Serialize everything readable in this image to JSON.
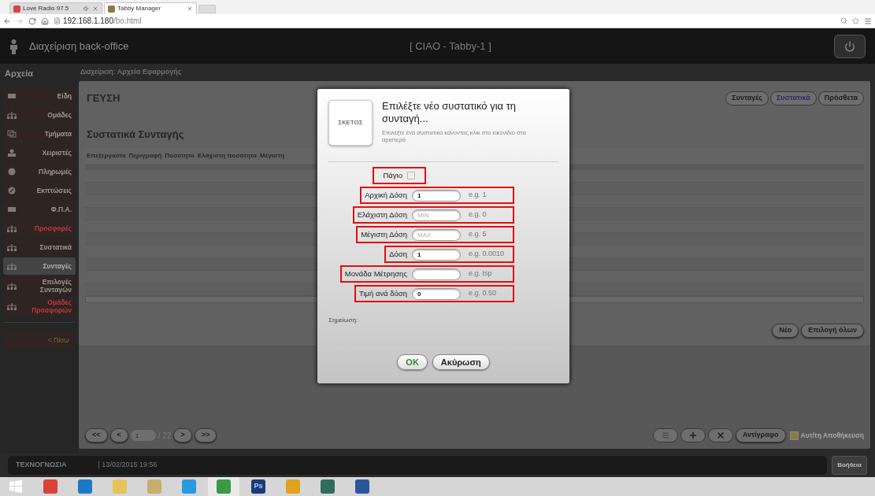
{
  "browser": {
    "tabs": [
      {
        "title": "Love Radio 97.5",
        "selected": false,
        "audio": true
      },
      {
        "title": "Tabby Manager",
        "selected": true,
        "audio": false
      }
    ],
    "address": {
      "host": "192.168.1.180",
      "path": "/bo.html"
    }
  },
  "header": {
    "title": "Διαχείριση back-office",
    "terminal": "[ CIAO - Tabby-1 ]"
  },
  "sidebar": {
    "title": "Αρχεία",
    "items": [
      {
        "label": "Είδη",
        "kind": "square",
        "warning": false,
        "selected": false
      },
      {
        "label": "Ομάδες",
        "kind": "tree",
        "warning": false,
        "selected": false
      },
      {
        "label": "Τμήματα",
        "kind": "windows",
        "warning": false,
        "selected": false
      },
      {
        "label": "Χειριστές",
        "kind": "person",
        "warning": false,
        "selected": false
      },
      {
        "label": "Πληρωμές",
        "kind": "coin",
        "warning": false,
        "selected": false
      },
      {
        "label": "Εκπτώσεις",
        "kind": "discount",
        "warning": false,
        "selected": false
      },
      {
        "label": "Φ.Π.Α.",
        "kind": "square",
        "warning": false,
        "selected": false
      },
      {
        "label": "Προσφορές",
        "kind": "tree",
        "warning": true,
        "selected": false
      },
      {
        "label": "Συστατικά",
        "kind": "tree",
        "warning": false,
        "selected": false
      },
      {
        "label": "Συνταγές",
        "kind": "tree",
        "warning": false,
        "selected": true
      },
      {
        "label": "Επιλογές Συνταγών",
        "kind": "tree",
        "warning": false,
        "selected": false
      },
      {
        "label": "Ομάδες Προσφορών",
        "kind": "tree",
        "warning": true,
        "selected": false
      }
    ],
    "back": "< Πίσω"
  },
  "breadcrumb": {
    "prefix": "Διαχείριση:",
    "current": "Αρχεία Εφαρμογής"
  },
  "recipe": {
    "name": "ΓΕΥΣΗ",
    "tabs": [
      {
        "label": "Συνταγές",
        "selected": false
      },
      {
        "label": "Συστατικά",
        "selected": true
      },
      {
        "label": "Πρόσθετα",
        "selected": false
      }
    ],
    "section_title": "Συστατικά Συνταγής",
    "table": {
      "columns": [
        "Επεξεργασία",
        "Περιγραφή",
        "Ποσότητα",
        "Ελάχιστη ποσότητα",
        "Μέγιστη"
      ]
    },
    "actions": [
      "Νέο",
      "Επιλογή όλων"
    ]
  },
  "pager": {
    "first": "<<",
    "prev": "<",
    "page": "1",
    "total": "/ 22",
    "next": ">",
    "last": ">>"
  },
  "toolbar": {
    "copy": "Αντίγραφο",
    "autosave": {
      "label": "Αυτ/τη Αποθήκευση",
      "checked": false
    }
  },
  "dialog": {
    "thumbnail": "ΣΚΕΤΟΣ",
    "title": "Επιλέξτε νέο συστατικό για τη συνταγή...",
    "hint": "Επιλέξτε ένα συστατικό κάνοντας κλικ στο εικονίδιο στα αριστερά",
    "fields": [
      {
        "kind": "checkbox",
        "label": "Πάγιο",
        "checked": false
      },
      {
        "kind": "text",
        "label": "Αρχική Δόση",
        "value": "1",
        "example": "e.g. 1"
      },
      {
        "kind": "text",
        "label": "Ελάχιστη Δόση",
        "placeholder": "MIN",
        "example": "e.g. 0"
      },
      {
        "kind": "text",
        "label": "Μέγιστη Δόση",
        "placeholder": "MAX",
        "example": "e.g. 5"
      },
      {
        "kind": "text",
        "label": "Δόση",
        "value": "1",
        "example": "e.g. 0.0010"
      },
      {
        "kind": "text",
        "label": "Μονάδα Μέτρησης",
        "example": "e.g. tsp"
      },
      {
        "kind": "text",
        "label": "Τιμή ανά δόση",
        "value": "0",
        "example": "e.g. 0.50"
      }
    ],
    "note_label": "Σημείωση:",
    "buttons": [
      {
        "label": "OK",
        "kind": "confirm"
      },
      {
        "label": "Ακύρωση",
        "kind": "cancel"
      }
    ]
  },
  "status_bar": {
    "brand": "ΤΕΧΝΟΓΝΩΣΙΑ",
    "datetime": "| 13/02/2015 19:56",
    "help": "Βοήθεια"
  },
  "taskbar": {
    "apps": [
      {
        "kind": "start",
        "color": "#ffffff",
        "selected": false
      },
      {
        "kind": "app",
        "color": "#d9413a",
        "selected": false
      },
      {
        "kind": "app",
        "color": "#1e78c8",
        "selected": false
      },
      {
        "kind": "app",
        "color": "#e6c45a",
        "selected": false
      },
      {
        "kind": "app",
        "color": "#c7ad6e",
        "selected": false
      },
      {
        "kind": "app",
        "color": "#2a9ae0",
        "selected": false
      },
      {
        "kind": "app",
        "color": "#3a9a45",
        "selected": true
      },
      {
        "kind": "app",
        "color": "#1d3a78",
        "label": "Ps",
        "selected": false
      },
      {
        "kind": "app",
        "color": "#e0a020",
        "selected": false
      },
      {
        "kind": "app",
        "color": "#2f6d5a",
        "selected": false
      },
      {
        "kind": "app",
        "color": "#2b579a",
        "selected": false
      }
    ]
  }
}
